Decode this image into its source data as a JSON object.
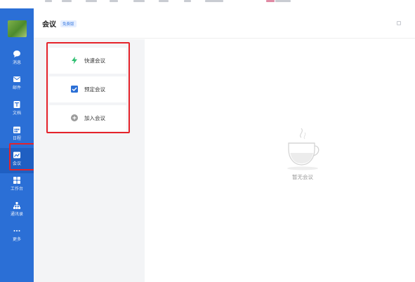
{
  "app": {
    "title": "会议",
    "badge": "免费版"
  },
  "sidebar": {
    "items": [
      {
        "label": "消息",
        "icon": "chat-bubble-icon"
      },
      {
        "label": "邮件",
        "icon": "mail-icon"
      },
      {
        "label": "文档",
        "icon": "document-icon"
      },
      {
        "label": "日程",
        "icon": "calendar-icon"
      },
      {
        "label": "会议",
        "icon": "meeting-icon",
        "active": true
      },
      {
        "label": "工作台",
        "icon": "grid-apps-icon"
      },
      {
        "label": "通讯录",
        "icon": "org-chart-icon"
      },
      {
        "label": "更多",
        "icon": "more-dots-icon"
      }
    ]
  },
  "actions": [
    {
      "label": "快速会议",
      "icon": "lightning-icon",
      "color": "#2fbf71"
    },
    {
      "label": "预定会议",
      "icon": "checkbox-icon",
      "color": "#2b6fd6"
    },
    {
      "label": "加入会议",
      "icon": "add-circle-icon",
      "color": "#9a9a9a"
    }
  ],
  "empty_state": {
    "text": "暂无会议",
    "icon": "coffee-cup-icon"
  },
  "colors": {
    "sidebar": "#2b6fd6",
    "highlight": "#e5222a",
    "accent": "#3b7be0"
  }
}
